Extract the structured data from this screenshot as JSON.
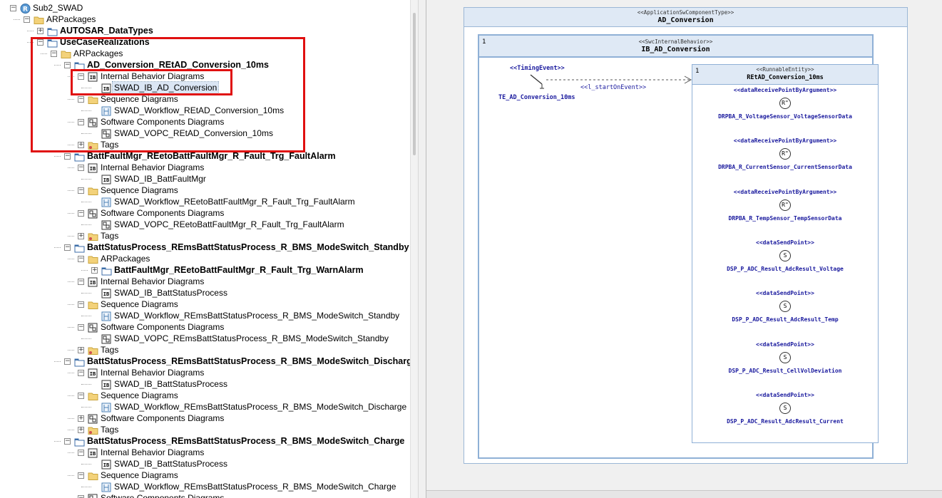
{
  "tree": {
    "rows": [
      {
        "label": "Sub2_SWAD",
        "icon": "package-root-icon",
        "level": 0,
        "expander": "minus",
        "bold": false
      },
      {
        "label": "ARPackages",
        "icon": "folder-icon",
        "level": 1,
        "expander": "minus",
        "bold": false
      },
      {
        "label": "AUTOSAR_DataTypes",
        "icon": "package-icon",
        "level": 2,
        "expander": "plus",
        "bold": true
      },
      {
        "label": "UseCaseRealizations",
        "icon": "package-icon",
        "level": 2,
        "expander": "minus",
        "bold": true
      },
      {
        "label": "ARPackages",
        "icon": "folder-icon",
        "level": 3,
        "expander": "minus",
        "bold": false
      },
      {
        "label": "AD_Conversion_REtAD_Conversion_10ms",
        "icon": "package-icon",
        "level": 4,
        "expander": "minus",
        "bold": true
      },
      {
        "label": "Internal Behavior Diagrams",
        "icon": "ib-diagram-icon",
        "level": 5,
        "expander": "minus",
        "bold": false
      },
      {
        "label": "SWAD_IB_AD_Conversion",
        "icon": "ib-diagram-icon",
        "level": 6,
        "expander": "",
        "bold": false,
        "selected": true
      },
      {
        "label": "Sequence Diagrams",
        "icon": "folder-icon",
        "level": 5,
        "expander": "minus",
        "bold": false
      },
      {
        "label": "SWAD_Workflow_REtAD_Conversion_10ms",
        "icon": "sequence-diagram-icon",
        "level": 6,
        "expander": "",
        "bold": false
      },
      {
        "label": "Software Components Diagrams",
        "icon": "component-diagram-icon",
        "level": 5,
        "expander": "minus",
        "bold": false
      },
      {
        "label": "SWAD_VOPC_REtAD_Conversion_10ms",
        "icon": "component-diagram-icon",
        "level": 6,
        "expander": "",
        "bold": false
      },
      {
        "label": "Tags",
        "icon": "tag-folder-icon",
        "level": 5,
        "expander": "plus",
        "bold": false
      },
      {
        "label": "BattFaultMgr_REetoBattFaultMgr_R_Fault_Trg_FaultAlarm",
        "icon": "package-icon",
        "level": 4,
        "expander": "minus",
        "bold": true
      },
      {
        "label": "Internal Behavior Diagrams",
        "icon": "ib-diagram-icon",
        "level": 5,
        "expander": "minus",
        "bold": false
      },
      {
        "label": "SWAD_IB_BattFaultMgr",
        "icon": "ib-diagram-icon",
        "level": 6,
        "expander": "",
        "bold": false
      },
      {
        "label": "Sequence Diagrams",
        "icon": "folder-icon",
        "level": 5,
        "expander": "minus",
        "bold": false
      },
      {
        "label": "SWAD_Workflow_REetoBattFaultMgr_R_Fault_Trg_FaultAlarm",
        "icon": "sequence-diagram-icon",
        "level": 6,
        "expander": "",
        "bold": false
      },
      {
        "label": "Software Components Diagrams",
        "icon": "component-diagram-icon",
        "level": 5,
        "expander": "minus",
        "bold": false
      },
      {
        "label": "SWAD_VOPC_REetoBattFaultMgr_R_Fault_Trg_FaultAlarm",
        "icon": "component-diagram-icon",
        "level": 6,
        "expander": "",
        "bold": false
      },
      {
        "label": "Tags",
        "icon": "tag-folder-icon",
        "level": 5,
        "expander": "plus",
        "bold": false
      },
      {
        "label": "BattStatusProcess_REmsBattStatusProcess_R_BMS_ModeSwitch_Standby",
        "icon": "package-icon",
        "level": 4,
        "expander": "minus",
        "bold": true
      },
      {
        "label": "ARPackages",
        "icon": "folder-icon",
        "level": 5,
        "expander": "minus",
        "bold": false
      },
      {
        "label": "BattFaultMgr_REetoBattFaultMgr_R_Fault_Trg_WarnAlarm",
        "icon": "package-icon",
        "level": 6,
        "expander": "plus",
        "bold": true
      },
      {
        "label": "Internal Behavior Diagrams",
        "icon": "ib-diagram-icon",
        "level": 5,
        "expander": "minus",
        "bold": false
      },
      {
        "label": "SWAD_IB_BattStatusProcess",
        "icon": "ib-diagram-icon",
        "level": 6,
        "expander": "",
        "bold": false
      },
      {
        "label": "Sequence Diagrams",
        "icon": "folder-icon",
        "level": 5,
        "expander": "minus",
        "bold": false
      },
      {
        "label": "SWAD_Workflow_REmsBattStatusProcess_R_BMS_ModeSwitch_Standby",
        "icon": "sequence-diagram-icon",
        "level": 6,
        "expander": "",
        "bold": false
      },
      {
        "label": "Software Components Diagrams",
        "icon": "component-diagram-icon",
        "level": 5,
        "expander": "minus",
        "bold": false
      },
      {
        "label": "SWAD_VOPC_REmsBattStatusProcess_R_BMS_ModeSwitch_Standby",
        "icon": "component-diagram-icon",
        "level": 6,
        "expander": "",
        "bold": false
      },
      {
        "label": "Tags",
        "icon": "tag-folder-icon",
        "level": 5,
        "expander": "plus",
        "bold": false
      },
      {
        "label": "BattStatusProcess_REmsBattStatusProcess_R_BMS_ModeSwitch_Discharge",
        "icon": "package-icon",
        "level": 4,
        "expander": "minus",
        "bold": true
      },
      {
        "label": "Internal Behavior Diagrams",
        "icon": "ib-diagram-icon",
        "level": 5,
        "expander": "minus",
        "bold": false
      },
      {
        "label": "SWAD_IB_BattStatusProcess",
        "icon": "ib-diagram-icon",
        "level": 6,
        "expander": "",
        "bold": false
      },
      {
        "label": "Sequence Diagrams",
        "icon": "folder-icon",
        "level": 5,
        "expander": "minus",
        "bold": false
      },
      {
        "label": "SWAD_Workflow_REmsBattStatusProcess_R_BMS_ModeSwitch_Discharge",
        "icon": "sequence-diagram-icon",
        "level": 6,
        "expander": "",
        "bold": false
      },
      {
        "label": "Software Components Diagrams",
        "icon": "component-diagram-icon",
        "level": 5,
        "expander": "plus",
        "bold": false
      },
      {
        "label": "Tags",
        "icon": "tag-folder-icon",
        "level": 5,
        "expander": "plus",
        "bold": false
      },
      {
        "label": "BattStatusProcess_REmsBattStatusProcess_R_BMS_ModeSwitch_Charge",
        "icon": "package-icon",
        "level": 4,
        "expander": "minus",
        "bold": true
      },
      {
        "label": "Internal Behavior Diagrams",
        "icon": "ib-diagram-icon",
        "level": 5,
        "expander": "minus",
        "bold": false
      },
      {
        "label": "SWAD_IB_BattStatusProcess",
        "icon": "ib-diagram-icon",
        "level": 6,
        "expander": "",
        "bold": false
      },
      {
        "label": "Sequence Diagrams",
        "icon": "folder-icon",
        "level": 5,
        "expander": "minus",
        "bold": false
      },
      {
        "label": "SWAD_Workflow_REmsBattStatusProcess_R_BMS_ModeSwitch_Charge",
        "icon": "sequence-diagram-icon",
        "level": 6,
        "expander": "",
        "bold": false
      },
      {
        "label": "Software Components Diagrams",
        "icon": "component-diagram-icon",
        "level": 5,
        "expander": "minus",
        "bold": false
      }
    ],
    "highlight_color": "#e01010"
  },
  "diagram": {
    "swc": {
      "stereotype": "<<ApplicationSwComponentType>>",
      "name": "AD_Conversion"
    },
    "internal_behavior": {
      "multiplicity": "1",
      "stereotype": "<<SwcInternalBehavior>>",
      "name": "IB_AD_Conversion"
    },
    "timing_event": {
      "stereotype": "<<TimingEvent>>",
      "name": "TE_AD_Conversion_10ms"
    },
    "trigger_label": "<<l_startOnEvent>>",
    "runnable": {
      "multiplicity": "1",
      "stereotype": "<<RunnableEntity>>",
      "name": "REtAD_Conversion_10ms",
      "accesses": [
        {
          "stereotype": "<<dataReceivePointByArgument>>",
          "symbol": "R\"",
          "name": "DRPBA_R_VoltageSensor_VoltageSensorData"
        },
        {
          "stereotype": "<<dataReceivePointByArgument>>",
          "symbol": "R\"",
          "name": "DRPBA_R_CurrentSensor_CurrentSensorData"
        },
        {
          "stereotype": "<<dataReceivePointByArgument>>",
          "symbol": "R\"",
          "name": "DRPBA_R_TempSensor_TempSensorData"
        },
        {
          "stereotype": "<<dataSendPoint>>",
          "symbol": "S",
          "name": "DSP_P_ADC_Result_AdcResult_Voltage"
        },
        {
          "stereotype": "<<dataSendPoint>>",
          "symbol": "S",
          "name": "DSP_P_ADC_Result_AdcResult_Temp"
        },
        {
          "stereotype": "<<dataSendPoint>>",
          "symbol": "S",
          "name": "DSP_P_ADC_Result_CellVolDeviation"
        },
        {
          "stereotype": "<<dataSendPoint>>",
          "symbol": "S",
          "name": "DSP_P_ADC_Result_AdcResult_Current"
        }
      ]
    }
  }
}
